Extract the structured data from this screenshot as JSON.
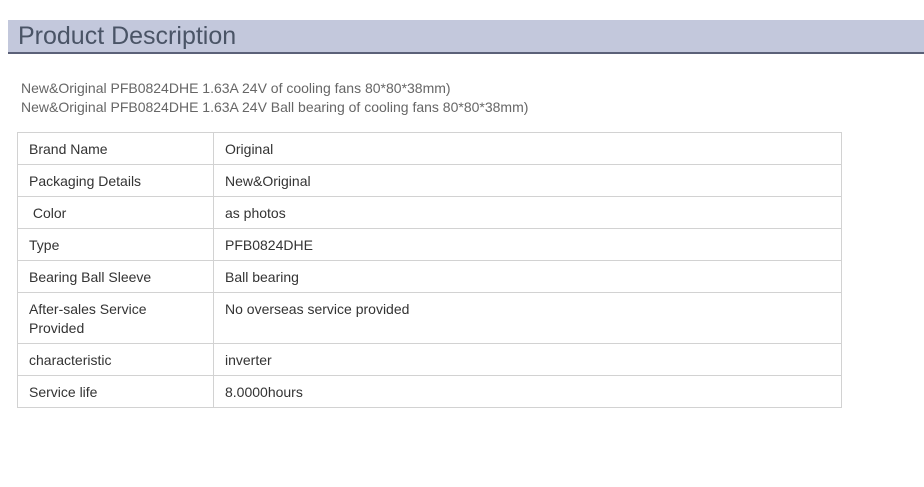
{
  "section": {
    "title": "Product Description"
  },
  "intro": {
    "line1": "New&Original PFB0824DHE 1.63A 24V of cooling fans 80*80*38mm)",
    "line2": "New&Original PFB0824DHE 1.63A 24V Ball bearing of cooling fans 80*80*38mm)"
  },
  "specs": [
    {
      "label": "Brand Name",
      "value": "Original"
    },
    {
      "label": "Packaging Details",
      "value": "New&Original"
    },
    {
      "label": " Color",
      "value": "as photos"
    },
    {
      "label": "Type",
      "value": "PFB0824DHE"
    },
    {
      "label": "Bearing Ball Sleeve",
      "value": "Ball bearing"
    },
    {
      "label": "After-sales Service Provided",
      "value": "No overseas service provided"
    },
    {
      "label": "characteristic",
      "value": "inverter"
    },
    {
      "label": "Service life",
      "value": "8.0000hours"
    }
  ]
}
